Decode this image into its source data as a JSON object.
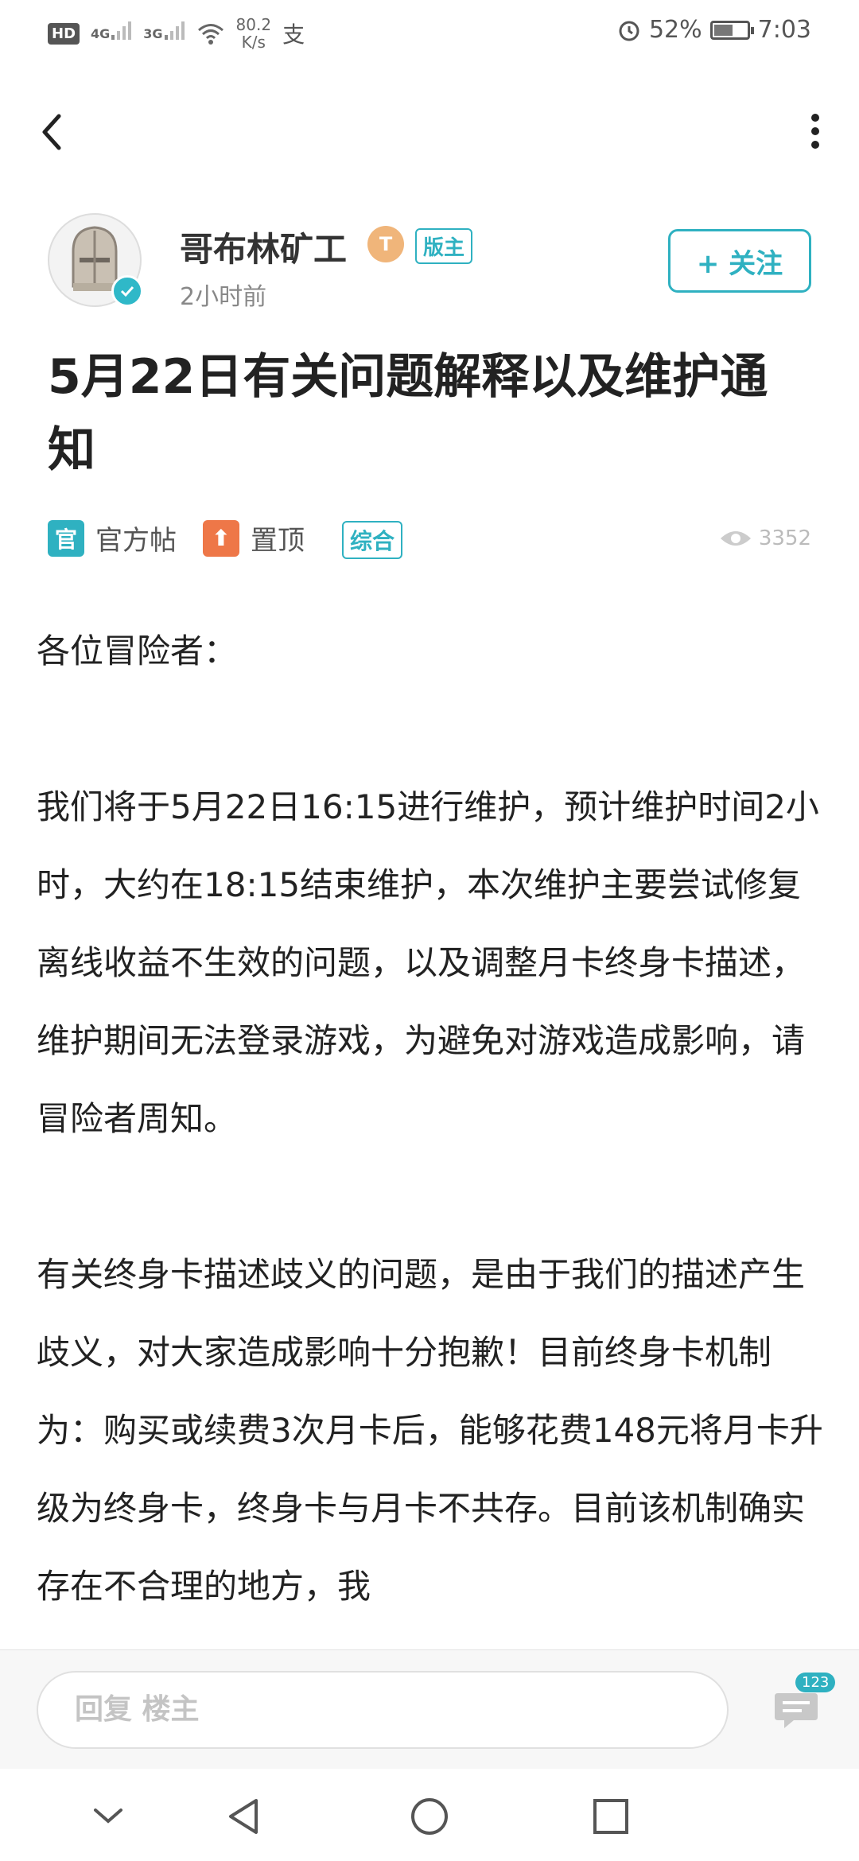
{
  "status_bar": {
    "hd": "HD",
    "sim1": "4G",
    "sim2": "3G",
    "speed_value": "80.2",
    "speed_unit": "K/s",
    "extra": "支",
    "battery_pct": "52%",
    "time": "7:03"
  },
  "author": {
    "name": "哥布林矿工",
    "level": "T",
    "role_badge": "版主",
    "time": "2小时前",
    "follow_label": "+ 关注"
  },
  "post": {
    "title": "5月22日有关问题解释以及维护通知",
    "tags": [
      {
        "icon_text": "官",
        "label": "官方帖",
        "color": "#2fb1c1"
      },
      {
        "icon_text": "⬆",
        "label": "置顶",
        "color": "#ee7748"
      }
    ],
    "category": "综合",
    "views": "3352",
    "paragraphs": [
      "各位冒险者：",
      "我们将于5月22日16:15进行维护，预计维护时间2小时，大约在18:15结束维护，本次维护主要尝试修复离线收益不生效的问题，以及调整月卡终身卡描述，维护期间无法登录游戏，为避免对游戏造成影响，请冒险者周知。",
      "有关终身卡描述歧义的问题，是由于我们的描述产生歧义，对大家造成影响十分抱歉！目前终身卡机制为：购买或续费3次月卡后，能够花费148元将月卡升级为终身卡，终身卡与月卡不共存。目前该机制确实存在不合理的地方，我"
    ]
  },
  "reply_bar": {
    "placeholder": "回复  楼主",
    "comment_count": "123"
  },
  "icons": {
    "back": "back-arrow-icon",
    "more": "more-vertical-icon",
    "eye": "eye-icon",
    "comment": "comment-bubble-icon"
  }
}
